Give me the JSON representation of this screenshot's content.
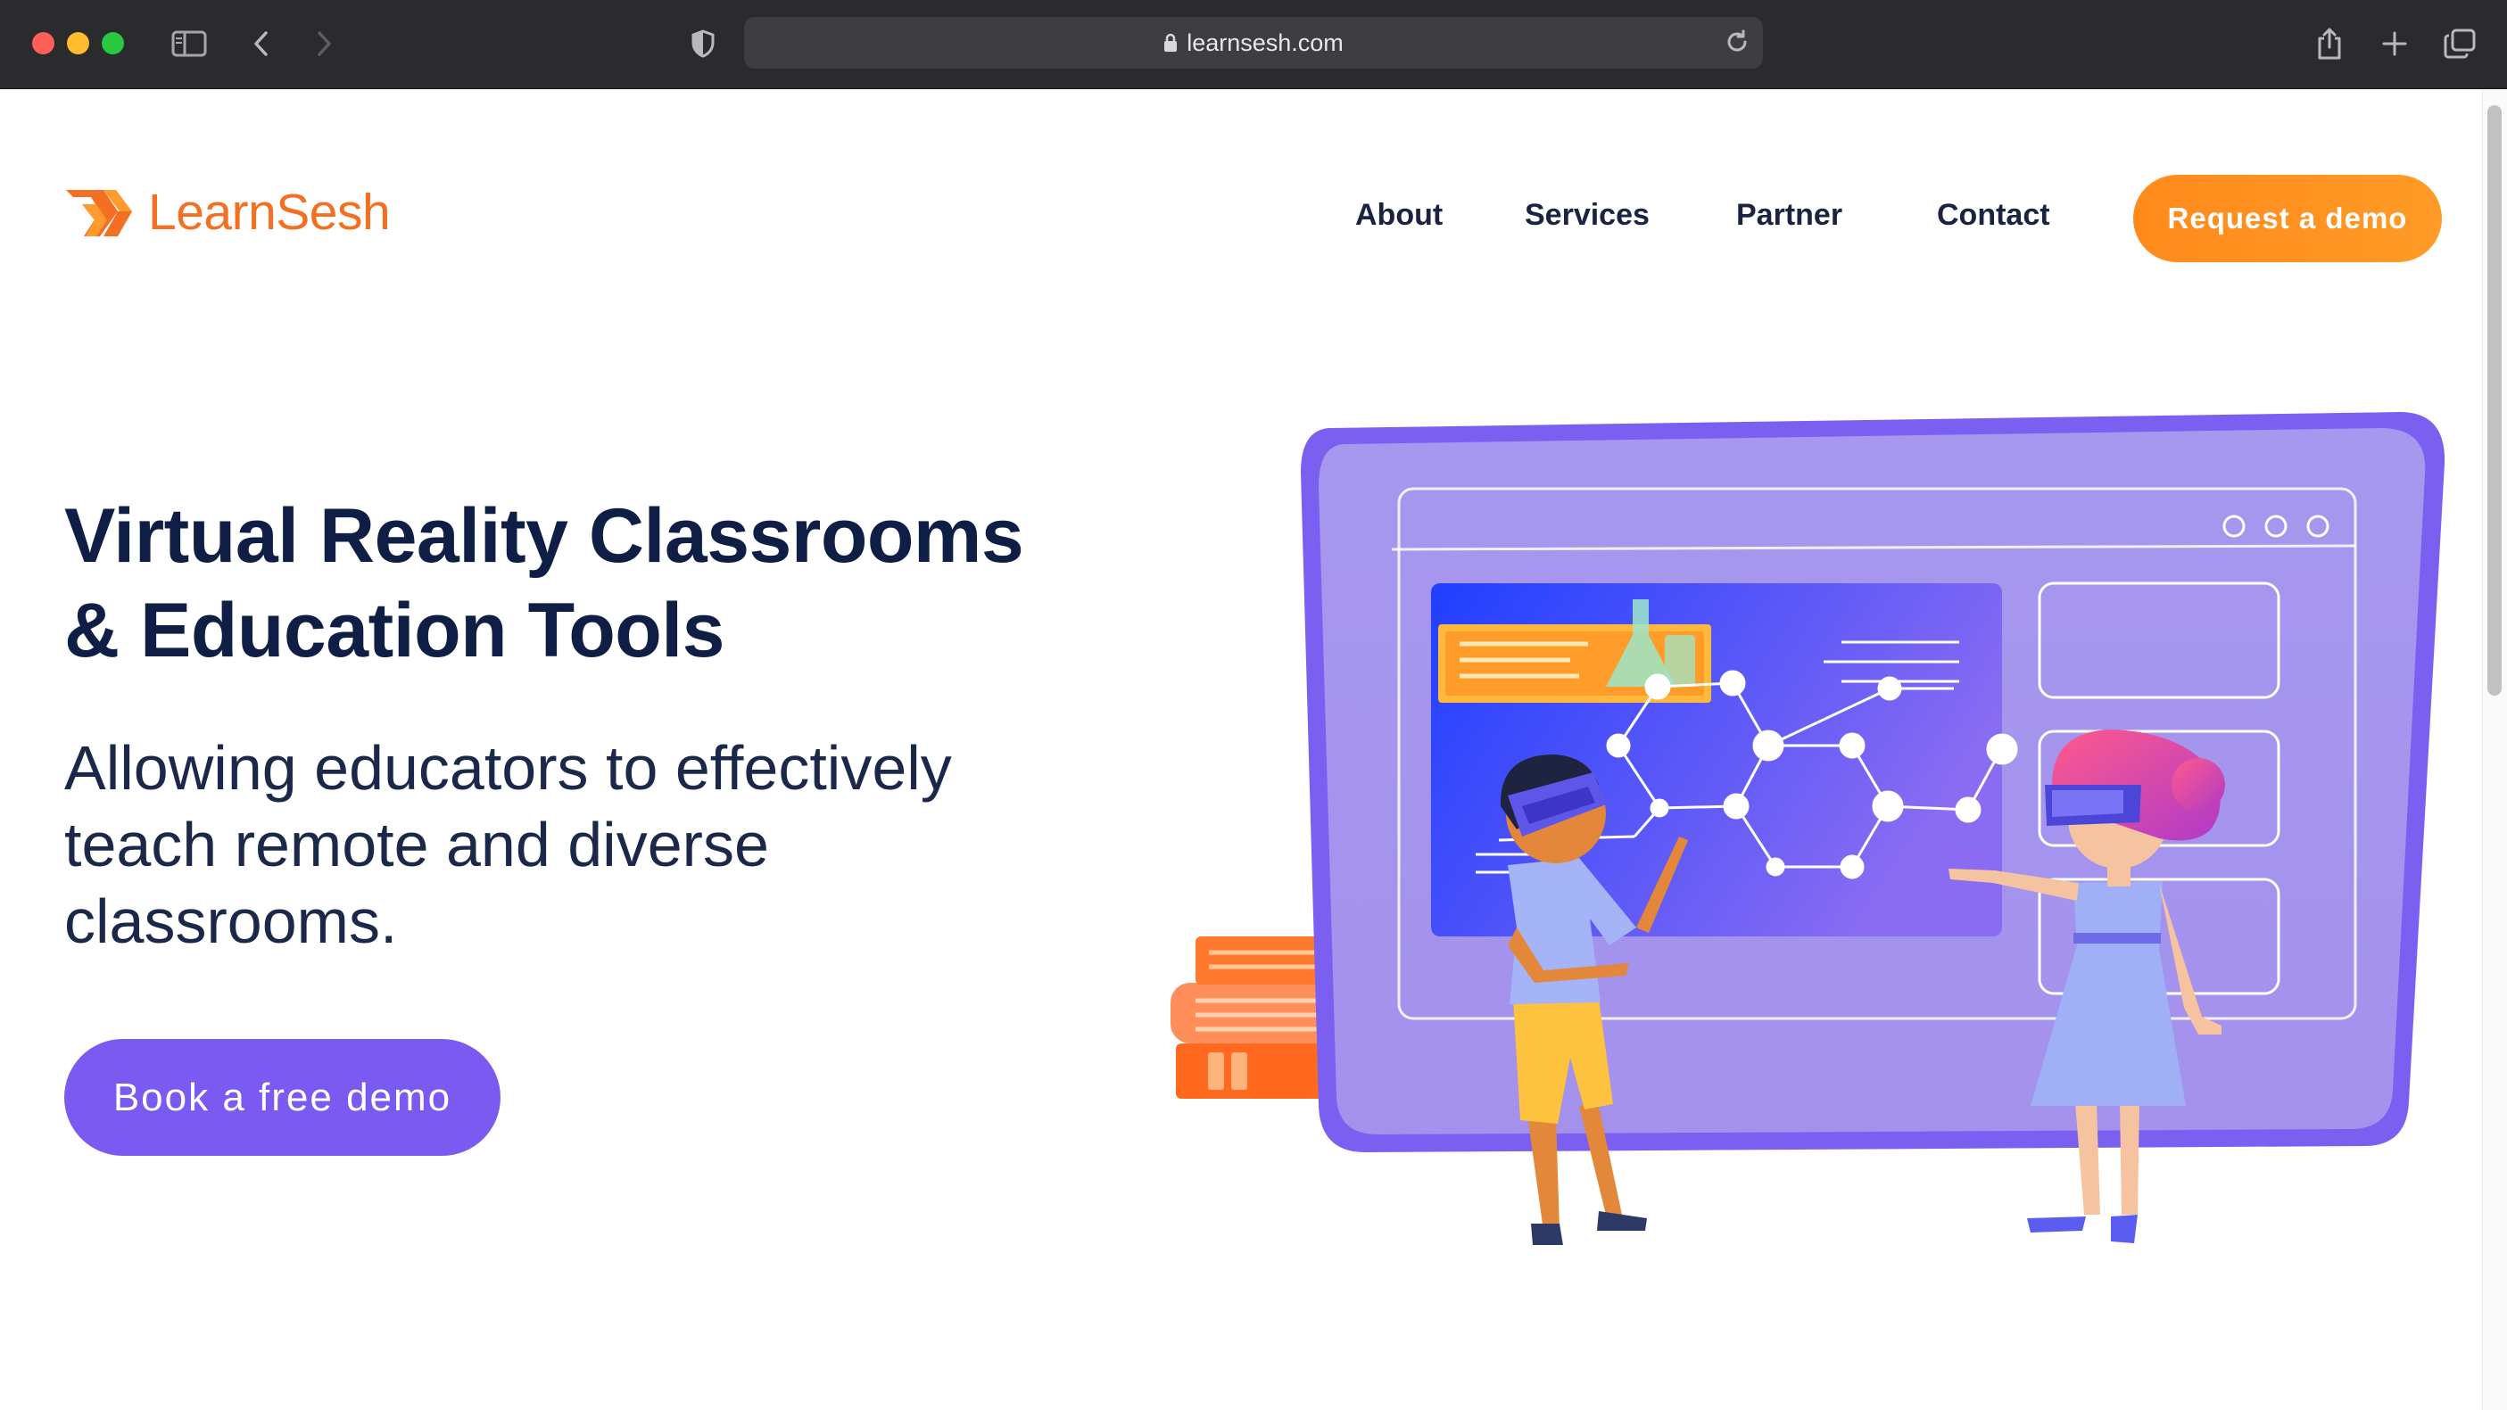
{
  "browser": {
    "url": "learnsesh.com",
    "icons": [
      "sidebar-icon",
      "back-icon",
      "forward-icon",
      "shield-icon",
      "lock-icon",
      "reload-icon",
      "share-icon",
      "new-tab-icon",
      "tabs-overview-icon"
    ]
  },
  "header": {
    "logo_text": "LearnSesh",
    "nav": [
      {
        "label": "About"
      },
      {
        "label": "Services"
      },
      {
        "label": "Partner"
      },
      {
        "label": "Contact"
      }
    ],
    "cta_label": "Request a demo"
  },
  "hero": {
    "title_line1": "Virtual Reality Classrooms",
    "title_line2": "& Education Tools",
    "subtitle_line1": "Allowing educators to effectively",
    "subtitle_line2": "teach remote and diverse",
    "subtitle_line3": "classrooms.",
    "cta_label": "Book a free demo"
  },
  "colors": {
    "brand_orange": "#f36f21",
    "cta_orange": "#ff8f1f",
    "accent_purple": "#7a5af0",
    "heading_navy": "#0f1e45",
    "chrome_bg": "#2b2a2d"
  }
}
